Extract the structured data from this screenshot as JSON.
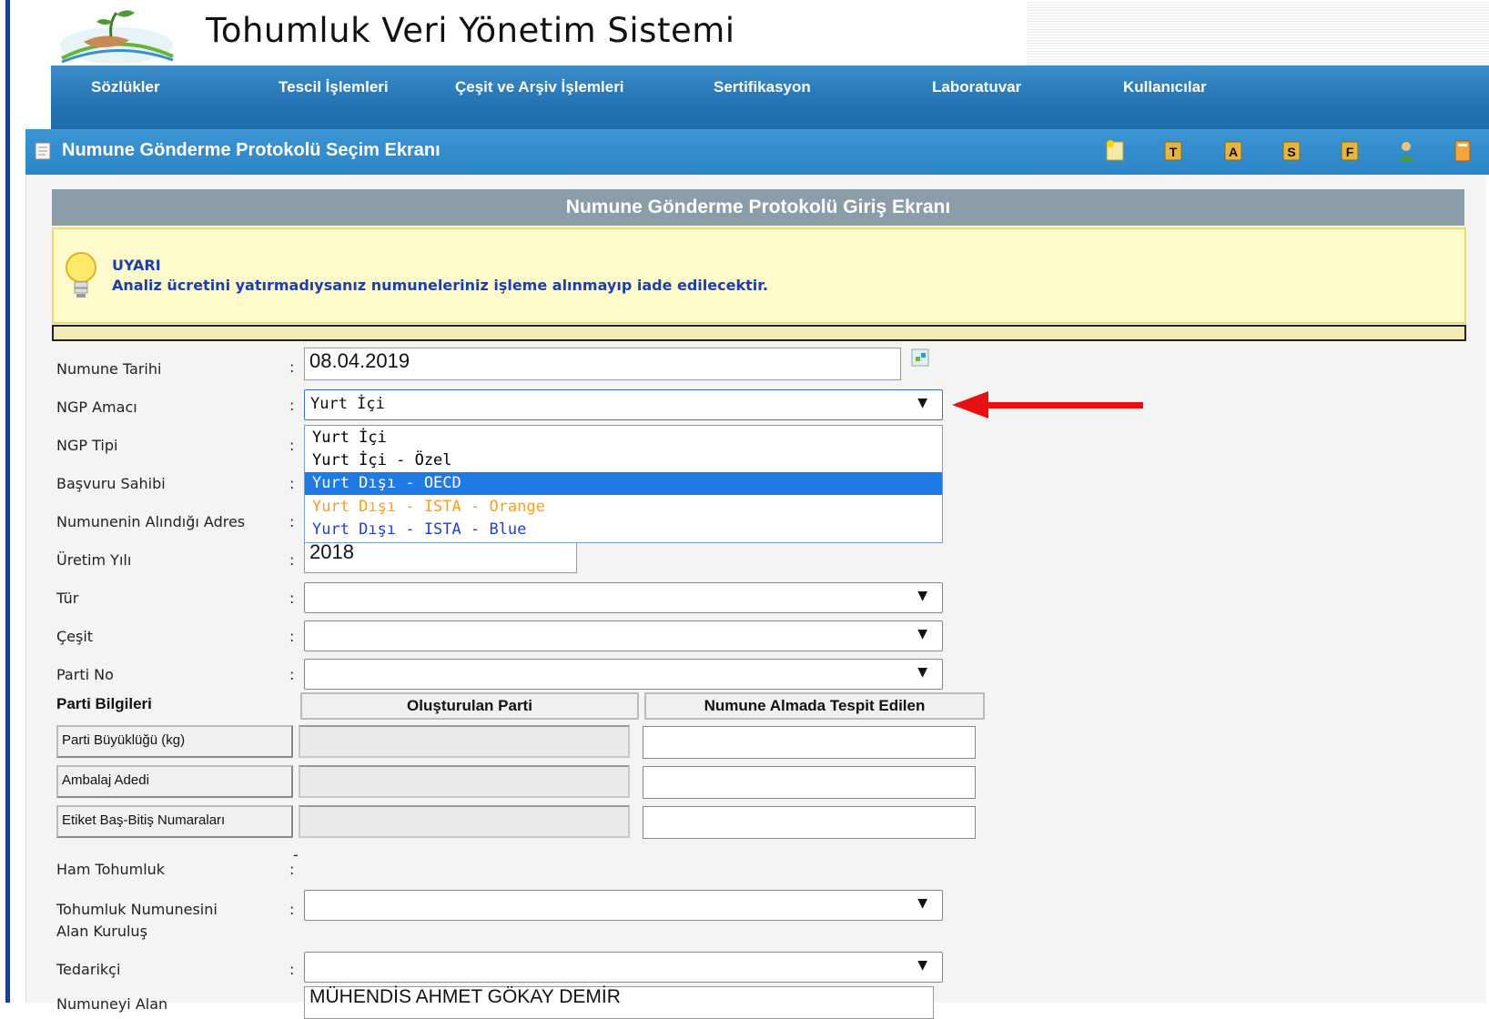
{
  "header": {
    "title": "Tohumluk Veri Yönetim Sistemi"
  },
  "nav": {
    "items": [
      {
        "label": "Sözlükler"
      },
      {
        "label": "Tescil İşlemleri"
      },
      {
        "label": "Çeşit ve Arşiv İşlemleri"
      },
      {
        "label": "Sertifikasyon"
      },
      {
        "label": "Laboratuvar"
      },
      {
        "label": "Kullanıcılar"
      }
    ]
  },
  "subbar": {
    "title": "Numune Gönderme Protokolü Seçim Ekranı",
    "toolbar_icons": [
      "new-document-icon",
      "t-icon",
      "a-icon",
      "s-icon",
      "f-icon",
      "user-icon",
      "exit-icon"
    ]
  },
  "panel": {
    "title": "Numune Gönderme Protokolü Giriş Ekranı"
  },
  "warning": {
    "title": "UYARI",
    "text": "Analiz ücretini yatırmadıysanız numuneleriniz işleme alınmayıp iade edilecektir."
  },
  "form": {
    "numune_tarihi": {
      "label": "Numune Tarihi",
      "value": "08.04.2019"
    },
    "ngp_amaci": {
      "label": "NGP Amacı",
      "value": "Yurt İçi",
      "options": [
        {
          "label": "Yurt İçi",
          "color": "#111111"
        },
        {
          "label": "Yurt İçi - Özel",
          "color": "#111111"
        },
        {
          "label": "Yurt Dışı - OECD",
          "color": "#ffffff",
          "selected": true
        },
        {
          "label": "Yurt Dışı - ISTA - Orange",
          "color": "#ff9b21"
        },
        {
          "label": "Yurt Dışı - ISTA - Blue",
          "color": "#1f3fd6"
        }
      ]
    },
    "ngp_tipi": {
      "label": "NGP Tipi"
    },
    "basvuru_sahibi": {
      "label": "Başvuru Sahibi"
    },
    "alindigi_adres": {
      "label": "Numunenin Alındığı Adres"
    },
    "uretim_yili": {
      "label": "Üretim Yılı",
      "value": "2018"
    },
    "tur": {
      "label": "Tür",
      "value": ""
    },
    "cesit": {
      "label": "Çeşit",
      "value": ""
    },
    "parti_no": {
      "label": "Parti No",
      "value": ""
    },
    "parti_bilgileri": {
      "label": "Parti Bilgileri",
      "col1": "Oluşturulan Parti",
      "col2": "Numune Almada Tespit Edilen",
      "rows": [
        {
          "label": "Parti Büyüklüğü (kg)"
        },
        {
          "label": "Ambalaj Adedi"
        },
        {
          "label": "Etiket Baş-Bitiş Numaraları"
        }
      ]
    },
    "ham_tohumluk": {
      "label": "Ham Tohumluk",
      "value": "-"
    },
    "alan_kurulus": {
      "label_line1": "Tohumluk Numunesini",
      "label_line2": "Alan Kuruluş",
      "value": ""
    },
    "tedarikci": {
      "label": "Tedarikçi",
      "value": ""
    },
    "numune_alan": {
      "label": "Numuneyi Alan",
      "value": "MÜHENDİS AHMET GÖKAY DEMİR"
    }
  },
  "colon": ":",
  "select_arrow": "▼",
  "colors": {
    "nav_blue": "#2373b5",
    "panel_gray": "#8b9da8",
    "warn_bg": "#fdfacc",
    "warn_text": "#1e3fa8",
    "highlight": "#1f7ae3",
    "red_arrow": "#e81010"
  }
}
